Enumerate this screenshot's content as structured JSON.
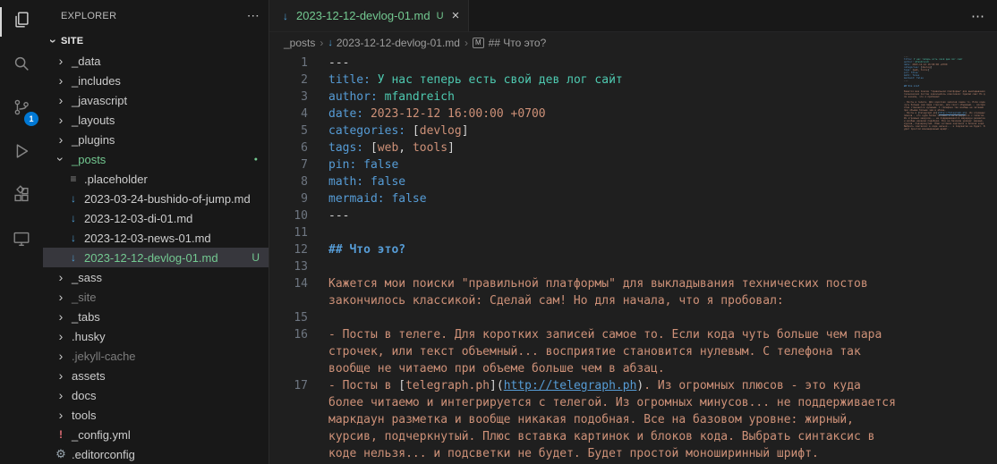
{
  "activity_bar": {
    "items": [
      {
        "icon": "explorer",
        "active": true
      },
      {
        "icon": "search"
      },
      {
        "icon": "source-control",
        "badge": "1"
      },
      {
        "icon": "run-debug"
      },
      {
        "icon": "extensions"
      },
      {
        "icon": "remote"
      }
    ]
  },
  "sidebar": {
    "title": "EXPLORER",
    "section": "SITE",
    "items": [
      {
        "label": "_data",
        "type": "folder",
        "indent": 1
      },
      {
        "label": "_includes",
        "type": "folder",
        "indent": 1
      },
      {
        "label": "_javascript",
        "type": "folder",
        "indent": 1
      },
      {
        "label": "_layouts",
        "type": "folder",
        "indent": 1
      },
      {
        "label": "_plugins",
        "type": "folder",
        "indent": 1
      },
      {
        "label": "_posts",
        "type": "folder",
        "indent": 1,
        "expanded": true,
        "git": "untracked",
        "dot": true
      },
      {
        "label": ".placeholder",
        "type": "file",
        "icon": "file",
        "indent": 2
      },
      {
        "label": "2023-03-24-bushido-of-jump.md",
        "type": "file",
        "icon": "markdown",
        "indent": 2
      },
      {
        "label": "2023-12-03-di-01.md",
        "type": "file",
        "icon": "markdown",
        "indent": 2
      },
      {
        "label": "2023-12-03-news-01.md",
        "type": "file",
        "icon": "markdown",
        "indent": 2
      },
      {
        "label": "2023-12-12-devlog-01.md",
        "type": "file",
        "icon": "markdown",
        "indent": 2,
        "git": "untracked",
        "badge": "U",
        "selected": true
      },
      {
        "label": "_sass",
        "type": "folder",
        "indent": 1
      },
      {
        "label": "_site",
        "type": "folder",
        "indent": 1,
        "dim": true
      },
      {
        "label": "_tabs",
        "type": "folder",
        "indent": 1
      },
      {
        "label": ".husky",
        "type": "folder",
        "indent": 1
      },
      {
        "label": ".jekyll-cache",
        "type": "folder",
        "indent": 1,
        "dim": true
      },
      {
        "label": "assets",
        "type": "folder",
        "indent": 1
      },
      {
        "label": "docs",
        "type": "folder",
        "indent": 1
      },
      {
        "label": "tools",
        "type": "folder",
        "indent": 1
      },
      {
        "label": "_config.yml",
        "type": "file",
        "icon": "yaml",
        "indent": 1
      },
      {
        "label": ".editorconfig",
        "type": "file",
        "icon": "editorconfig",
        "indent": 1
      }
    ]
  },
  "tab": {
    "label": "2023-12-12-devlog-01.md",
    "git_badge": "U"
  },
  "breadcrumbs": [
    {
      "label": "_posts"
    },
    {
      "label": "2023-12-12-devlog-01.md",
      "icon": "markdown"
    },
    {
      "label": "## Что это?",
      "icon": "symbol"
    }
  ],
  "editor": {
    "lines": [
      {
        "num": 1,
        "segments": [
          {
            "t": "---",
            "c": "g"
          }
        ]
      },
      {
        "num": 2,
        "segments": [
          {
            "t": "title:",
            "c": "k"
          },
          {
            "t": " У нас теперь есть свой дев лог сайт",
            "c": "t"
          }
        ]
      },
      {
        "num": 3,
        "segments": [
          {
            "t": "author:",
            "c": "k"
          },
          {
            "t": " mfandreich",
            "c": "t"
          }
        ]
      },
      {
        "num": 4,
        "segments": [
          {
            "t": "date:",
            "c": "k"
          },
          {
            "t": " 2023-12-12 16:00:00 +0700",
            "c": "o"
          }
        ]
      },
      {
        "num": 5,
        "segments": [
          {
            "t": "categories:",
            "c": "k"
          },
          {
            "t": " [",
            "c": "g"
          },
          {
            "t": "devlog",
            "c": "o"
          },
          {
            "t": "]",
            "c": "g"
          }
        ]
      },
      {
        "num": 6,
        "segments": [
          {
            "t": "tags:",
            "c": "k"
          },
          {
            "t": " [",
            "c": "g"
          },
          {
            "t": "web",
            "c": "o"
          },
          {
            "t": ", ",
            "c": "g"
          },
          {
            "t": "tools",
            "c": "o"
          },
          {
            "t": "]",
            "c": "g"
          }
        ]
      },
      {
        "num": 7,
        "segments": [
          {
            "t": "pin:",
            "c": "k"
          },
          {
            "t": " false",
            "c": "b"
          }
        ]
      },
      {
        "num": 8,
        "segments": [
          {
            "t": "math:",
            "c": "k"
          },
          {
            "t": " false",
            "c": "b"
          }
        ]
      },
      {
        "num": 9,
        "segments": [
          {
            "t": "mermaid:",
            "c": "k"
          },
          {
            "t": " false",
            "c": "b"
          }
        ]
      },
      {
        "num": 10,
        "segments": [
          {
            "t": "---",
            "c": "g"
          }
        ]
      },
      {
        "num": 11,
        "segments": []
      },
      {
        "num": 12,
        "segments": [
          {
            "t": "## Что это?",
            "c": "h"
          }
        ]
      },
      {
        "num": 13,
        "segments": []
      },
      {
        "num": 14,
        "segments": [
          {
            "t": "Кажется мои поиски \"правильной платформы\" для выкладывания технических постов закончилось классикой: Сделай сам! Но для начала, что я пробовал:",
            "c": "o"
          }
        ]
      },
      {
        "num": 15,
        "segments": []
      },
      {
        "num": 16,
        "segments": [
          {
            "t": "- Посты в телеге. Для коротких записей самое то. Если кода чуть больше чем пара строчек, или текст объемный... восприятие становится нулевым. С телефона так вообще не читаемо при объеме больше чем в абзац.",
            "c": "o"
          }
        ]
      },
      {
        "num": 17,
        "segments": [
          {
            "t": "- Посты в ",
            "c": "o"
          },
          {
            "t": "[",
            "c": "g"
          },
          {
            "t": "telegraph.ph",
            "c": "o"
          },
          {
            "t": "](",
            "c": "g"
          },
          {
            "t": "http://telegraph.ph",
            "c": "u"
          },
          {
            "t": ")",
            "c": "g"
          },
          {
            "t": ". Из огромных плюсов - это куда более читаемо и интегрируется с телегой. Из огромных минусов... не поддерживается маркдаун разметка и вообще никакая подобная. Все на базовом уровне: жирный, курсив, подчеркнутый. Плюс вставка картинок и блоков кода. Выбрать синтаксис в коде нельзя... и подсветки не будет. Будет простой моноширинный шрифт.",
            "c": "o"
          }
        ]
      }
    ]
  },
  "colors": {
    "accent": "#0078d4",
    "git_untracked": "#73c991",
    "editor_bg": "#1f1f1f",
    "sidebar_bg": "#181818",
    "selection_bg": "#37373d",
    "yaml_key": "#569cd6",
    "string_orange": "#ce9178",
    "value_teal": "#4ec9b0"
  }
}
